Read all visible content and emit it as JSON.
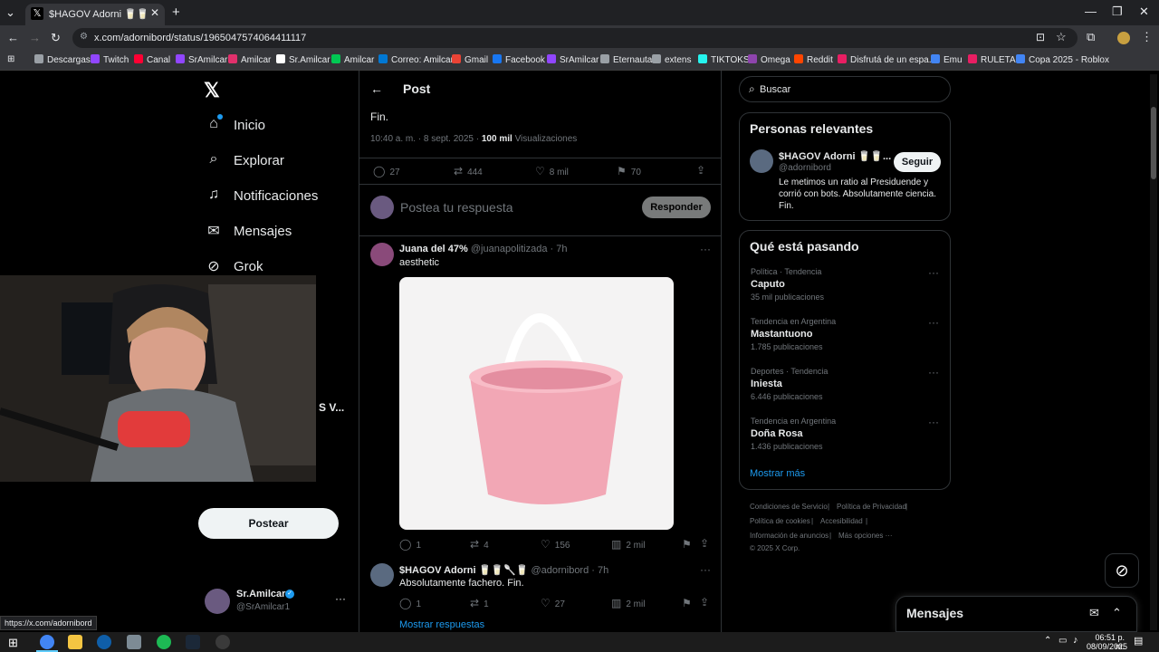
{
  "browser": {
    "tab_title": "$HAGOV Adorni 🥛🥛🥛🥛 en X",
    "url": "x.com/adornibord/status/1965047574064411117",
    "status_url": "https://x.com/adornibord",
    "bookmarks": [
      {
        "label": "Descargas",
        "color": "#9aa0a6"
      },
      {
        "label": "Twitch",
        "color": "#9146ff"
      },
      {
        "label": "Canal",
        "color": "#ff0033"
      },
      {
        "label": "SrAmilcar",
        "color": "#9146ff"
      },
      {
        "label": "Amilcar",
        "color": "#e1306c"
      },
      {
        "label": "Sr.Amilcar",
        "color": "#ffffff"
      },
      {
        "label": "Amilcar",
        "color": "#00c853"
      },
      {
        "label": "Correo: Amilcar",
        "color": "#0078d4"
      },
      {
        "label": "Gmail",
        "color": "#ea4335"
      },
      {
        "label": "Facebook",
        "color": "#1877f2"
      },
      {
        "label": "SrAmilcar",
        "color": "#9146ff"
      },
      {
        "label": "Eternauta",
        "color": "#9aa0a6"
      },
      {
        "label": "extens",
        "color": "#9aa0a6"
      },
      {
        "label": "TIKTOKS",
        "color": "#25f4ee"
      },
      {
        "label": "Omega",
        "color": "#8e44ad"
      },
      {
        "label": "Reddit",
        "color": "#ff4500"
      },
      {
        "label": "Disfrutá de un espa...",
        "color": "#e91e63"
      },
      {
        "label": "Emu",
        "color": "#4285f4"
      },
      {
        "label": "RULETA",
        "color": "#e91e63"
      },
      {
        "label": "Copa 2025 - Roblox",
        "color": "#4285f4"
      }
    ]
  },
  "nav": {
    "items": [
      {
        "label": "Inicio",
        "icon": "home-icon"
      },
      {
        "label": "Explorar",
        "icon": "search-icon"
      },
      {
        "label": "Notificaciones",
        "icon": "bell-icon"
      },
      {
        "label": "Mensajes",
        "icon": "mail-icon"
      },
      {
        "label": "Grok",
        "icon": "grok-icon"
      }
    ],
    "partial_label": "S V...",
    "post_button": "Postear",
    "account_name": "Sr.Amilcar",
    "account_handle": "@SrAmilcar1"
  },
  "header": {
    "title": "Post"
  },
  "main_post": {
    "text_tail": "Fin.",
    "time": "10:40 a. m. · 8 sept. 2025 · ",
    "views_count": "100 mil",
    "views_label": "Visualizaciones",
    "replies": "27",
    "reposts": "444",
    "likes": "8 mil",
    "bookmarks": "70"
  },
  "reply_box": {
    "placeholder": "Postea tu respuesta",
    "button": "Responder"
  },
  "replies": [
    {
      "name": "Juana del 47%",
      "handle": "@juanapolitizada",
      "time": "· 7h",
      "text": "aesthetic",
      "image": "pink-bucket",
      "replies": "1",
      "reposts": "4",
      "likes": "156",
      "views": "2 mil"
    },
    {
      "name": "$HAGOV Adorni 🥛🥛🥄🥛",
      "handle": "@adornibord",
      "time": "· 7h",
      "text": "Absolutamente fachero. Fin.",
      "replies": "1",
      "reposts": "1",
      "likes": "27",
      "views": "2 mil"
    }
  ],
  "show_replies": "Mostrar respuestas",
  "sidebar": {
    "search_placeholder": "Buscar",
    "relevant_title": "Personas relevantes",
    "relevant_name": "$HAGOV Adorni 🥛🥛...",
    "relevant_handle": "@adornibord",
    "relevant_bio": "Le metimos un ratio al Presiduende y corrió con bots. Absolutamente ciencia. Fin.",
    "follow_button": "Seguir",
    "trends_title": "Qué está pasando",
    "trends": [
      {
        "category": "Política · Tendencia",
        "name": "Caputo",
        "count": "35 mil publicaciones"
      },
      {
        "category": "Tendencia en Argentina",
        "name": "Mastantuono",
        "count": "1.785 publicaciones"
      },
      {
        "category": "Deportes · Tendencia",
        "name": "Iniesta",
        "count": "6.446 publicaciones"
      },
      {
        "category": "Tendencia en Argentina",
        "name": "Doña Rosa",
        "count": "1.436 publicaciones"
      }
    ],
    "show_more": "Mostrar más",
    "footer": {
      "terms": "Condiciones de Servicio",
      "privacy": "Política de Privacidad",
      "cookies": "Política de cookies",
      "accessibility": "Accesibilidad",
      "ads": "Información de anuncios",
      "more": "Más opciones ···",
      "copyright": "© 2025 X Corp."
    }
  },
  "messages_drawer": {
    "title": "Mensajes"
  },
  "taskbar": {
    "time": "06:51 p. m.",
    "date": "08/09/2025"
  },
  "colors": {
    "accent": "#1d9bf0",
    "bg": "#000000",
    "border": "#2f3336",
    "muted": "#71767b"
  }
}
